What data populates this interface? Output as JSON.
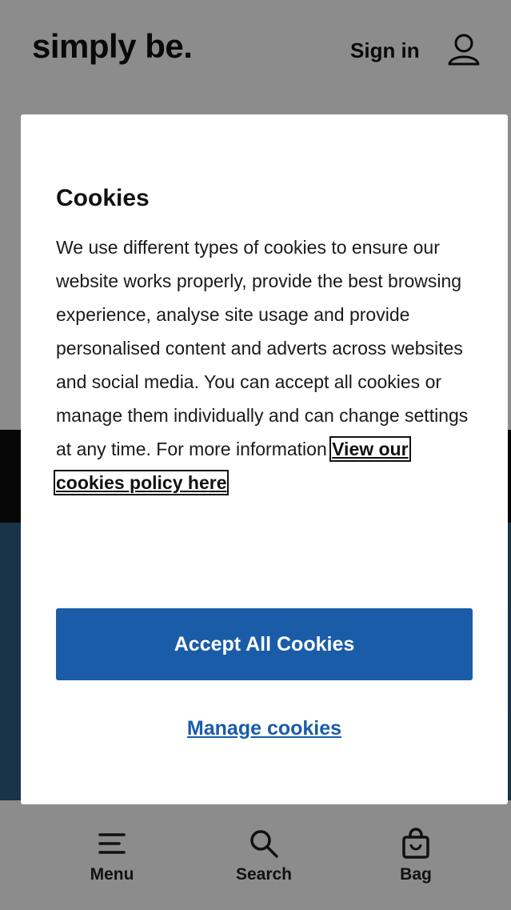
{
  "header": {
    "logo": "simply be.",
    "sign_in_label": "Sign in"
  },
  "cookie_modal": {
    "title": "Cookies",
    "body": "We use different types of cookies to ensure our website works properly, provide the best browsing experience, analyse site usage and provide personalised content and adverts across websites and social media. You can accept all cookies or manage them individually and can change settings at any time. For more information ",
    "policy_link": "View our cookies policy here",
    "accept_label": "Accept All Cookies",
    "manage_label": "Manage cookies"
  },
  "bottom_nav": {
    "items": [
      {
        "label": "Menu",
        "icon": "menu-icon"
      },
      {
        "label": "Search",
        "icon": "search-icon"
      },
      {
        "label": "Bag",
        "icon": "bag-icon"
      }
    ]
  },
  "colors": {
    "accent": "#1a5ca8",
    "overlay": "#8a8a8a"
  }
}
